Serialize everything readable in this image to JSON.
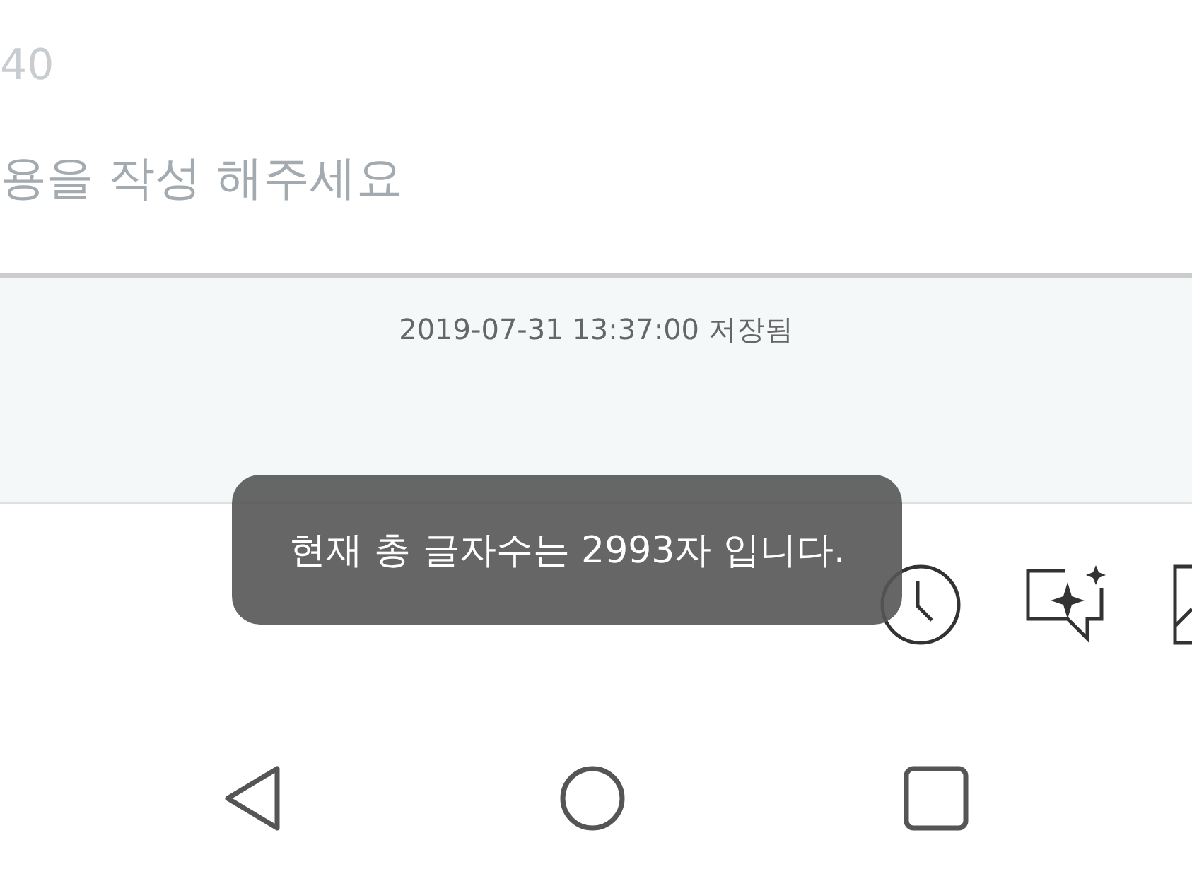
{
  "editor": {
    "counter": "40",
    "body_placeholder": "용을 작성 해주세요"
  },
  "save_status": "2019-07-31 13:37:00 저장됨",
  "toolbar": [
    {
      "kind": "clock"
    },
    {
      "kind": "sparkle-chat"
    },
    {
      "kind": "image"
    }
  ],
  "toast": "현재 총 글자수는 2993자 입니다.",
  "nav_bar": [
    {
      "kind": "back"
    },
    {
      "kind": "home"
    },
    {
      "kind": "recents"
    }
  ]
}
